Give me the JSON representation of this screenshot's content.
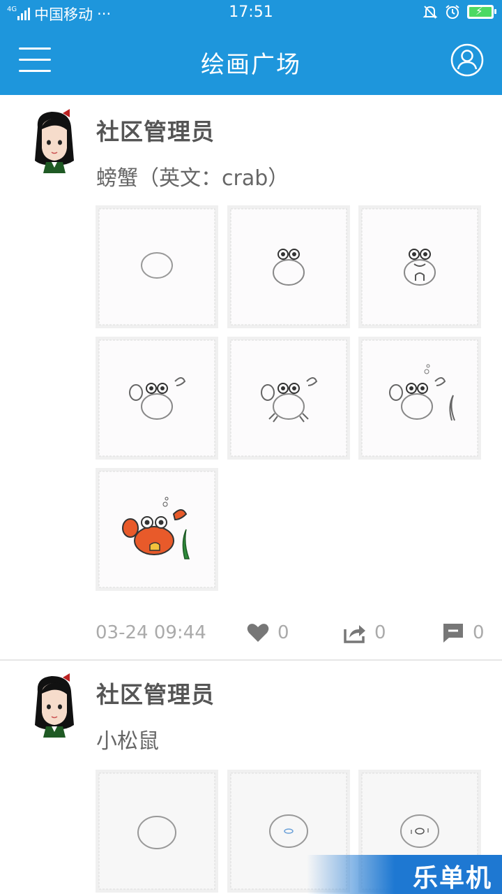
{
  "status_bar": {
    "network": "4G",
    "carrier": "中国移动",
    "dots": "···",
    "time": "17:51"
  },
  "app_bar": {
    "title": "绘画广场",
    "menu_icon": "hamburger-menu-icon",
    "profile_icon": "user-profile-icon",
    "color": "#1e96dc"
  },
  "posts": [
    {
      "author": "社区管理员",
      "caption": "螃蟹（英文：crab）",
      "timestamp": "03-24 09:44",
      "likes": "0",
      "shares": "0",
      "comments": "0",
      "images": [
        "crab-step-1",
        "crab-step-2",
        "crab-step-3",
        "crab-step-4",
        "crab-step-5",
        "crab-step-6",
        "crab-step-7"
      ]
    },
    {
      "author": "社区管理员",
      "caption": "小松鼠",
      "images": [
        "squirrel-step-1",
        "squirrel-step-2",
        "squirrel-step-3"
      ]
    }
  ],
  "watermark": {
    "text": "乐单机"
  }
}
